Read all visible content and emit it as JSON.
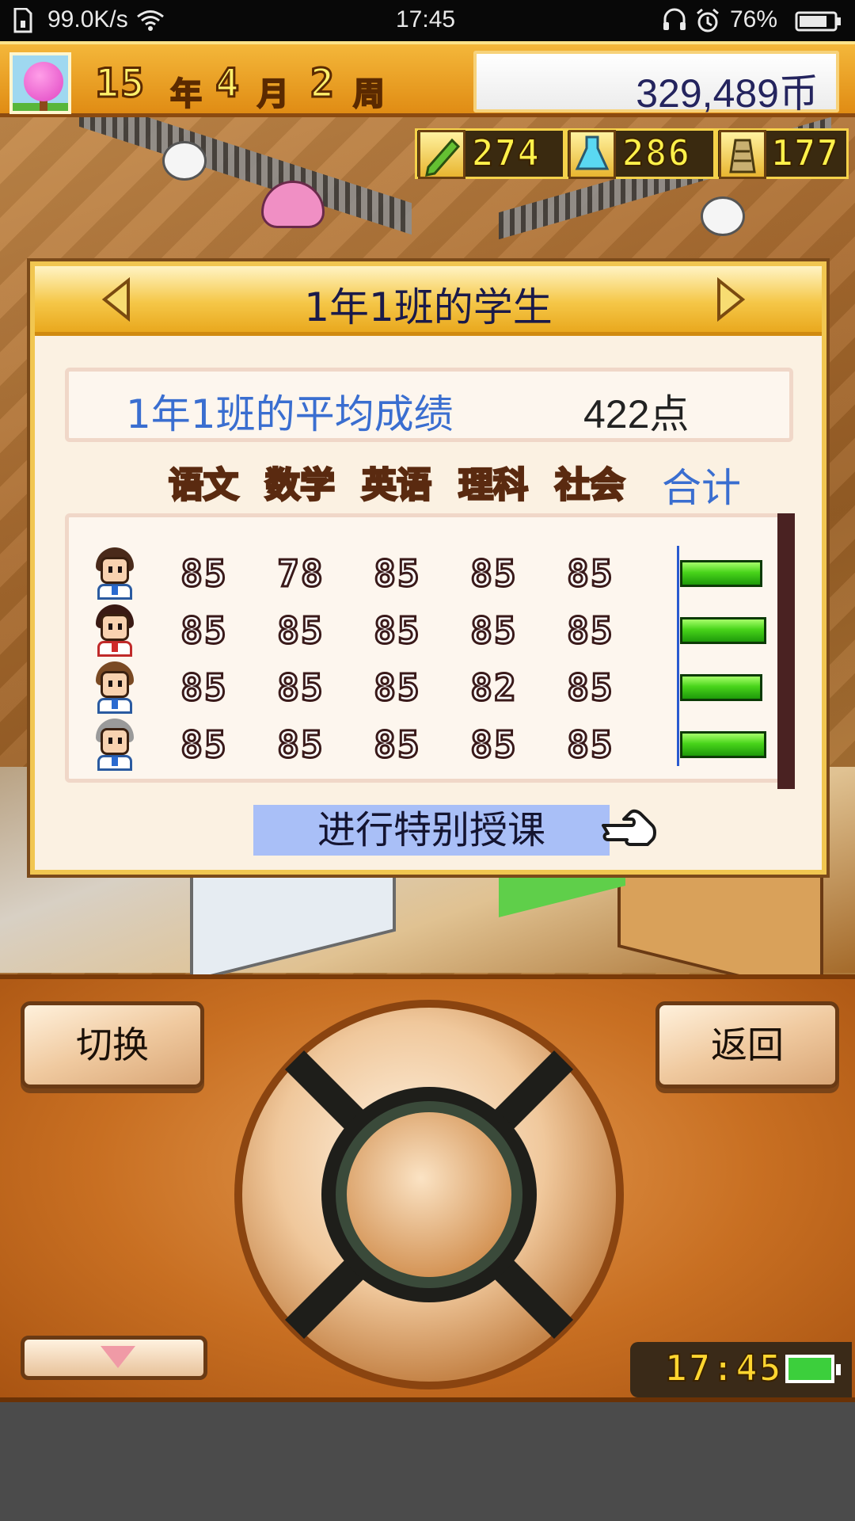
{
  "status_bar": {
    "speed": "99.0K/s",
    "time": "17:45",
    "battery_percent": "76%",
    "icons": [
      "sim-card-icon",
      "wifi-icon",
      "headphones-icon",
      "alarm-icon",
      "battery-icon"
    ]
  },
  "hud": {
    "year": "15",
    "year_unit": "年",
    "month": "4",
    "month_unit": "月",
    "week": "2",
    "week_unit": "周",
    "money": "329,489币",
    "avatar_icon": "cherry-tree-icon"
  },
  "resources": [
    {
      "icon": "pencil-icon",
      "value": "274"
    },
    {
      "icon": "flask-icon",
      "value": "286"
    },
    {
      "icon": "trophy-icon",
      "value": "177"
    }
  ],
  "dialog": {
    "title": "1年1班的学生",
    "average_label": "1年1班的平均成绩",
    "average_value": "422点",
    "subjects": [
      "语文",
      "数学",
      "英语",
      "理科",
      "社会"
    ],
    "total_label": "合计",
    "students": [
      {
        "scores": [
          "85",
          "78",
          "85",
          "85",
          "85"
        ],
        "total_fraction": 0.93
      },
      {
        "scores": [
          "85",
          "85",
          "85",
          "85",
          "85"
        ],
        "total_fraction": 0.97
      },
      {
        "scores": [
          "85",
          "85",
          "85",
          "82",
          "85"
        ],
        "total_fraction": 0.93
      },
      {
        "scores": [
          "85",
          "85",
          "85",
          "85",
          "85"
        ],
        "total_fraction": 0.97
      }
    ],
    "special_button": "进行特别授课"
  },
  "controller": {
    "switch_label": "切换",
    "back_label": "返回",
    "clock": "17:45"
  },
  "colors": {
    "accent_blue": "#3a6ed0",
    "score_bar_green": "#48d41a",
    "dialog_header_gold": "#f5c748",
    "controller_orange": "#c86f22"
  }
}
